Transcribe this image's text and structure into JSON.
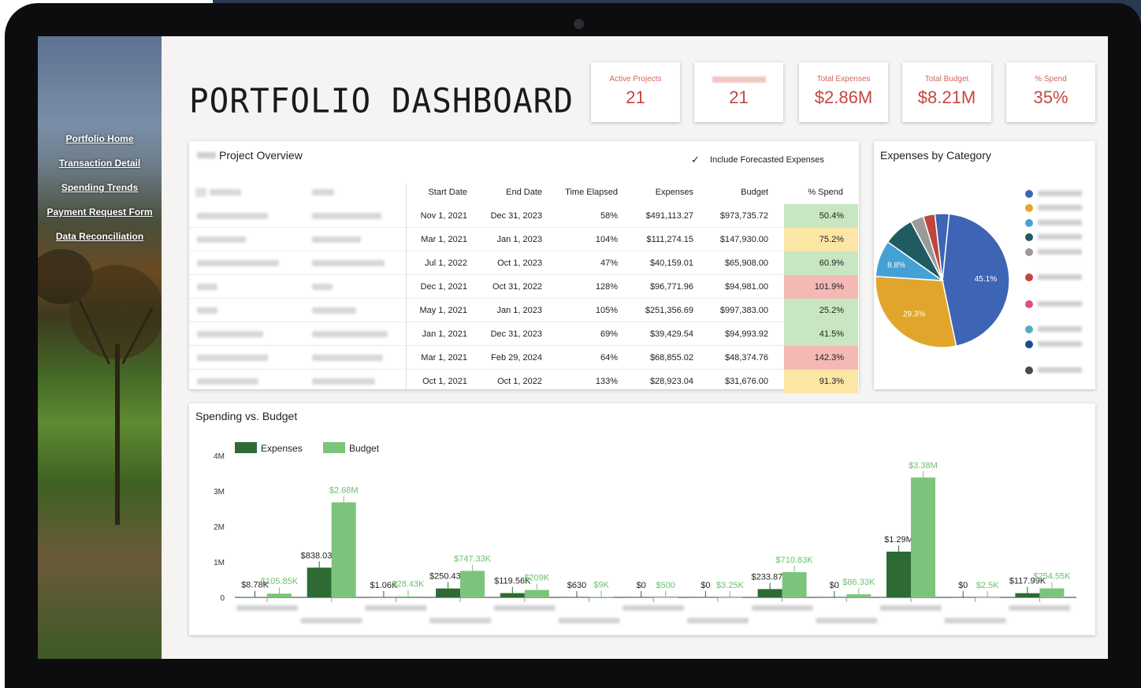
{
  "nav": [
    {
      "label": "Portfolio Home"
    },
    {
      "label": "Transaction Detail"
    },
    {
      "label": "Spending Trends"
    },
    {
      "label": "Payment Request Form"
    },
    {
      "label": "Data Reconciliation"
    }
  ],
  "title": "PORTFOLIO DASHBOARD",
  "kpis": [
    {
      "label": "Active Projects",
      "value": "21"
    },
    {
      "label": "",
      "value": "21"
    },
    {
      "label": "Total Expenses",
      "value": "$2.86M"
    },
    {
      "label": "Total Budget",
      "value": "$8.21M"
    },
    {
      "label": "% Spend",
      "value": "35%"
    }
  ],
  "overview": {
    "title": "Project Overview",
    "forecast_label": "Include Forecasted Expenses",
    "columns": [
      "Start Date",
      "End Date",
      "Time Elapsed",
      "Expenses",
      "Budget",
      "% Spend"
    ],
    "rows": [
      {
        "start": "Nov 1, 2021",
        "end": "Dec 31, 2023",
        "elapsed": "58%",
        "expenses": "$491,113.27",
        "budget": "$973,735.72",
        "spend": "50.4%",
        "status": "green"
      },
      {
        "start": "Mar 1, 2021",
        "end": "Jan 1, 2023",
        "elapsed": "104%",
        "expenses": "$111,274.15",
        "budget": "$147,930.00",
        "spend": "75.2%",
        "status": "yellow"
      },
      {
        "start": "Jul 1, 2022",
        "end": "Oct 1, 2023",
        "elapsed": "47%",
        "expenses": "$40,159.01",
        "budget": "$65,908.00",
        "spend": "60.9%",
        "status": "green"
      },
      {
        "start": "Dec 1, 2021",
        "end": "Oct 31, 2022",
        "elapsed": "128%",
        "expenses": "$96,771.96",
        "budget": "$94,981.00",
        "spend": "101.9%",
        "status": "red"
      },
      {
        "start": "May 1, 2021",
        "end": "Jan 1, 2023",
        "elapsed": "105%",
        "expenses": "$251,356.69",
        "budget": "$997,383.00",
        "spend": "25.2%",
        "status": "green"
      },
      {
        "start": "Jan 1, 2021",
        "end": "Dec 31, 2023",
        "elapsed": "69%",
        "expenses": "$39,429.54",
        "budget": "$94,993.92",
        "spend": "41.5%",
        "status": "green"
      },
      {
        "start": "Mar 1, 2021",
        "end": "Feb 29, 2024",
        "elapsed": "64%",
        "expenses": "$68,855.02",
        "budget": "$48,374.76",
        "spend": "142.3%",
        "status": "red"
      },
      {
        "start": "Oct 1, 2021",
        "end": "Oct 1, 2022",
        "elapsed": "133%",
        "expenses": "$28,923.04",
        "budget": "$31,676.00",
        "spend": "91.3%",
        "status": "yellow"
      }
    ],
    "status_colors": {
      "green": "#c9e6c3",
      "yellow": "#fbe6a4",
      "red": "#f4b8b5"
    }
  },
  "pie": {
    "title": "Expenses by Category",
    "slices": [
      {
        "value": 45.1,
        "label": "45.1%",
        "color": "#3d64b5"
      },
      {
        "value": 29.3,
        "label": "29.3%",
        "color": "#e2a52c"
      },
      {
        "value": 8.8,
        "label": "8.8%",
        "color": "#45a1d5"
      },
      {
        "value": 7.4,
        "label": "",
        "color": "#1f5c61"
      },
      {
        "value": 3.2,
        "label": "",
        "color": "#9a9a9a"
      },
      {
        "value": 2.8,
        "label": "",
        "color": "#c0463c"
      },
      {
        "value": 3.4,
        "label": "",
        "color": "#3d64b5"
      }
    ],
    "legend_colors": [
      "#3d64b5",
      "#e2a52c",
      "#45a1d5",
      "#1f5c61",
      "#9a9a9a",
      "#c0463c",
      "#e04b8c",
      "#5ba9c2",
      "#1c4c8c",
      "#4a4a4a"
    ]
  },
  "chart_data": {
    "type": "bar",
    "title": "Spending vs. Budget",
    "series": [
      {
        "name": "Expenses",
        "color": "#2e6b34",
        "values": [
          8780,
          838030,
          1060,
          250430,
          119560,
          630,
          0,
          0,
          233870,
          0,
          1290000,
          0,
          117990
        ],
        "labels": [
          "$8.78K",
          "$838.03K",
          "$1.06K",
          "$250.43K",
          "$119.56K",
          "$630",
          "$0",
          "$0",
          "$233.87K",
          "$0",
          "$1.29M",
          "$0",
          "$117.99K"
        ]
      },
      {
        "name": "Budget",
        "color": "#7cc47c",
        "values": [
          105850,
          2680000,
          28430,
          747330,
          209000,
          9000,
          500,
          3250,
          710830,
          86330,
          3380000,
          2500,
          254550
        ],
        "labels": [
          "$105.85K",
          "$2.68M",
          "$28.43K",
          "$747.33K",
          "$209K",
          "$9K",
          "$500",
          "$3.25K",
          "$710.83K",
          "$86.33K",
          "$3.38M",
          "$2.5K",
          "$254.55K"
        ]
      }
    ],
    "ylim": [
      0,
      4000000
    ],
    "yticks": [
      "0",
      "1M",
      "2M",
      "3M",
      "4M"
    ],
    "legend": "top-left"
  }
}
